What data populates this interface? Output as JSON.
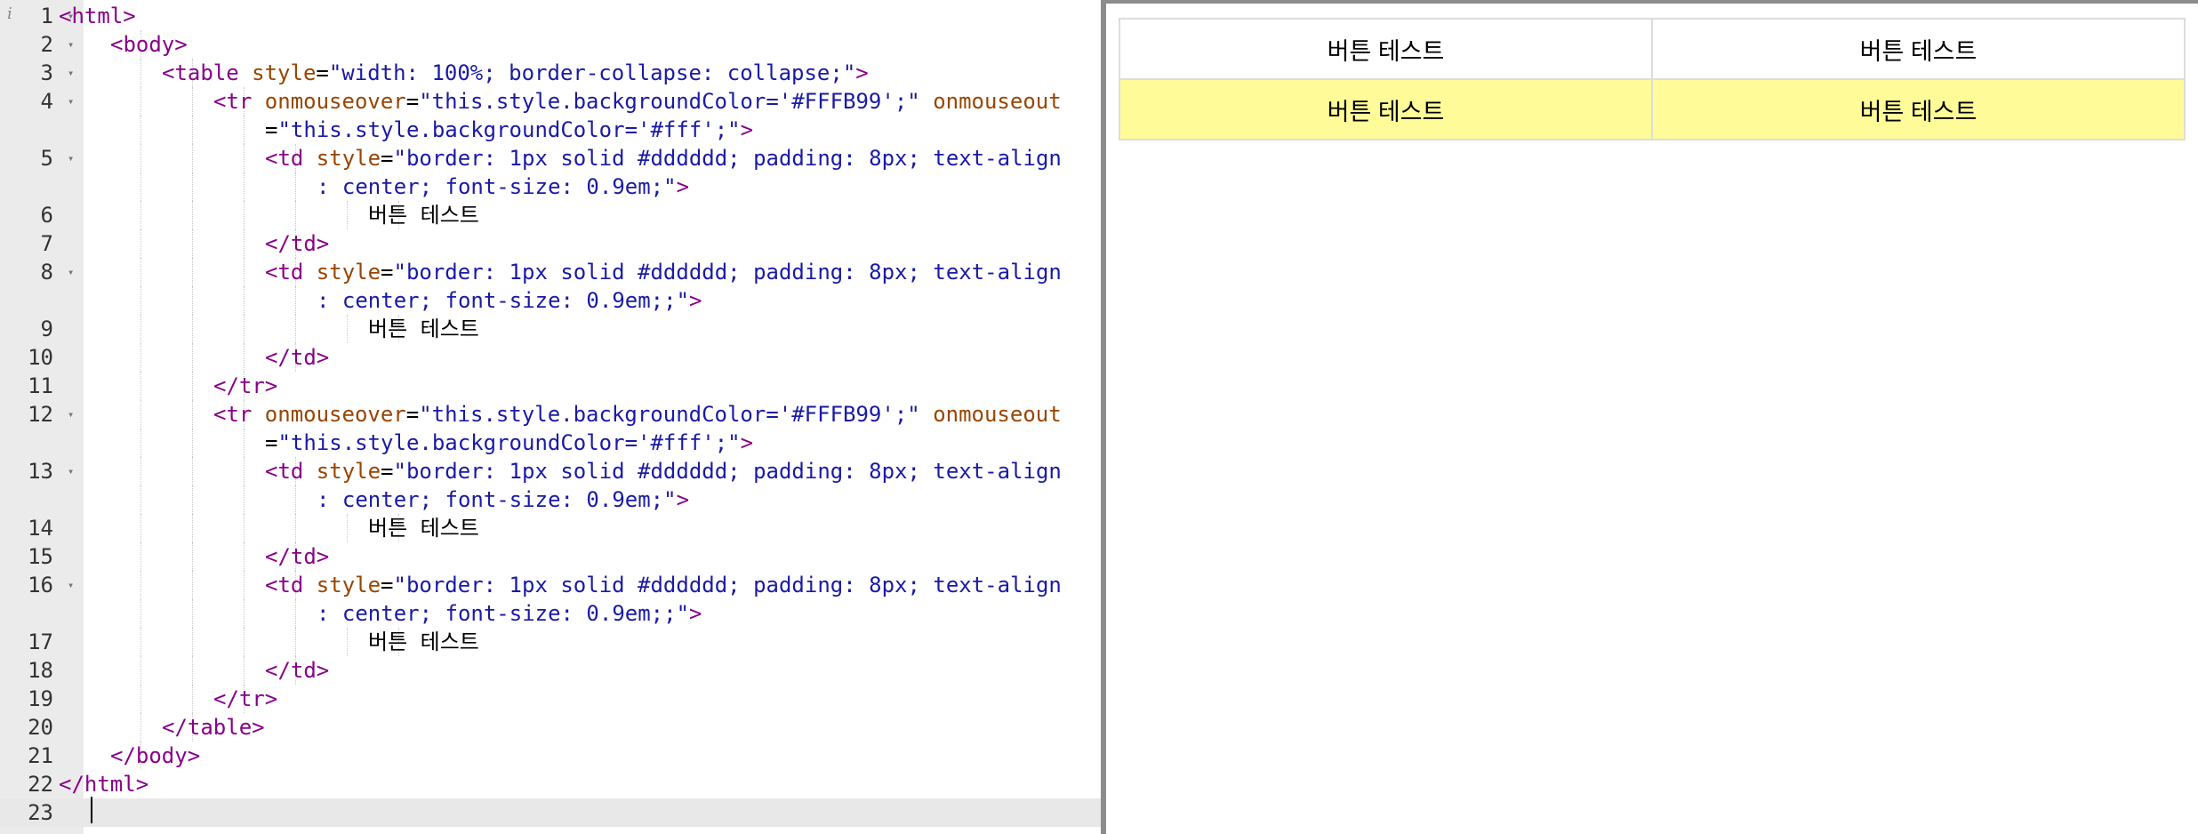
{
  "editor": {
    "active_line": 23,
    "lines": [
      {
        "num": "1",
        "fold": true,
        "indent": 0,
        "tokens": [
          {
            "t": "tag",
            "v": "<html>"
          }
        ]
      },
      {
        "num": "2",
        "fold": true,
        "indent": 1,
        "tokens": [
          {
            "t": "tag",
            "v": "<body>"
          }
        ]
      },
      {
        "num": "3",
        "fold": true,
        "indent": 2,
        "tokens": [
          {
            "t": "tag",
            "v": "<table "
          },
          {
            "t": "attr",
            "v": "style"
          },
          {
            "t": "txt",
            "v": "="
          },
          {
            "t": "str",
            "v": "\"width: 100%; border-collapse: collapse;\""
          },
          {
            "t": "tag",
            "v": ">"
          }
        ]
      },
      {
        "num": "4",
        "fold": true,
        "indent": 3,
        "tokens": [
          {
            "t": "tag",
            "v": "<tr "
          },
          {
            "t": "attr",
            "v": "onmouseover"
          },
          {
            "t": "txt",
            "v": "="
          },
          {
            "t": "str",
            "v": "\"this.style.backgroundColor='#FFFB99';\""
          },
          {
            "t": "txt",
            "v": " "
          },
          {
            "t": "attr",
            "v": "onmouseout"
          }
        ]
      },
      {
        "num": "",
        "fold": false,
        "indent": 4,
        "tokens": [
          {
            "t": "txt",
            "v": "="
          },
          {
            "t": "str",
            "v": "\"this.style.backgroundColor='#fff';\""
          },
          {
            "t": "tag",
            "v": ">"
          }
        ]
      },
      {
        "num": "5",
        "fold": true,
        "indent": 4,
        "tokens": [
          {
            "t": "tag",
            "v": "<td "
          },
          {
            "t": "attr",
            "v": "style"
          },
          {
            "t": "txt",
            "v": "="
          },
          {
            "t": "str",
            "v": "\"border: 1px solid #dddddd; padding: 8px; text-align"
          }
        ]
      },
      {
        "num": "",
        "fold": false,
        "indent": 5,
        "tokens": [
          {
            "t": "str",
            "v": ": center; font-size: 0.9em;\""
          },
          {
            "t": "tag",
            "v": ">"
          }
        ]
      },
      {
        "num": "6",
        "fold": false,
        "indent": 6,
        "tokens": [
          {
            "t": "txt",
            "v": "버튼 테스트"
          }
        ]
      },
      {
        "num": "7",
        "fold": false,
        "indent": 4,
        "tokens": [
          {
            "t": "tag",
            "v": "</td>"
          }
        ]
      },
      {
        "num": "8",
        "fold": true,
        "indent": 4,
        "tokens": [
          {
            "t": "tag",
            "v": "<td "
          },
          {
            "t": "attr",
            "v": "style"
          },
          {
            "t": "txt",
            "v": "="
          },
          {
            "t": "str",
            "v": "\"border: 1px solid #dddddd; padding: 8px; text-align"
          }
        ]
      },
      {
        "num": "",
        "fold": false,
        "indent": 5,
        "tokens": [
          {
            "t": "str",
            "v": ": center; font-size: 0.9em;;\""
          },
          {
            "t": "tag",
            "v": ">"
          }
        ]
      },
      {
        "num": "9",
        "fold": false,
        "indent": 6,
        "tokens": [
          {
            "t": "txt",
            "v": "버튼 테스트"
          }
        ]
      },
      {
        "num": "10",
        "fold": false,
        "indent": 4,
        "tokens": [
          {
            "t": "tag",
            "v": "</td>"
          }
        ]
      },
      {
        "num": "11",
        "fold": false,
        "indent": 3,
        "tokens": [
          {
            "t": "tag",
            "v": "</tr>"
          }
        ]
      },
      {
        "num": "12",
        "fold": true,
        "indent": 3,
        "tokens": [
          {
            "t": "tag",
            "v": "<tr "
          },
          {
            "t": "attr",
            "v": "onmouseover"
          },
          {
            "t": "txt",
            "v": "="
          },
          {
            "t": "str",
            "v": "\"this.style.backgroundColor='#FFFB99';\""
          },
          {
            "t": "txt",
            "v": " "
          },
          {
            "t": "attr",
            "v": "onmouseout"
          }
        ]
      },
      {
        "num": "",
        "fold": false,
        "indent": 4,
        "tokens": [
          {
            "t": "txt",
            "v": "="
          },
          {
            "t": "str",
            "v": "\"this.style.backgroundColor='#fff';\""
          },
          {
            "t": "tag",
            "v": ">"
          }
        ]
      },
      {
        "num": "13",
        "fold": true,
        "indent": 4,
        "tokens": [
          {
            "t": "tag",
            "v": "<td "
          },
          {
            "t": "attr",
            "v": "style"
          },
          {
            "t": "txt",
            "v": "="
          },
          {
            "t": "str",
            "v": "\"border: 1px solid #dddddd; padding: 8px; text-align"
          }
        ]
      },
      {
        "num": "",
        "fold": false,
        "indent": 5,
        "tokens": [
          {
            "t": "str",
            "v": ": center; font-size: 0.9em;\""
          },
          {
            "t": "tag",
            "v": ">"
          }
        ]
      },
      {
        "num": "14",
        "fold": false,
        "indent": 6,
        "tokens": [
          {
            "t": "txt",
            "v": "버튼 테스트"
          }
        ]
      },
      {
        "num": "15",
        "fold": false,
        "indent": 4,
        "tokens": [
          {
            "t": "tag",
            "v": "</td>"
          }
        ]
      },
      {
        "num": "16",
        "fold": true,
        "indent": 4,
        "tokens": [
          {
            "t": "tag",
            "v": "<td "
          },
          {
            "t": "attr",
            "v": "style"
          },
          {
            "t": "txt",
            "v": "="
          },
          {
            "t": "str",
            "v": "\"border: 1px solid #dddddd; padding: 8px; text-align"
          }
        ]
      },
      {
        "num": "",
        "fold": false,
        "indent": 5,
        "tokens": [
          {
            "t": "str",
            "v": ": center; font-size: 0.9em;;\""
          },
          {
            "t": "tag",
            "v": ">"
          }
        ]
      },
      {
        "num": "17",
        "fold": false,
        "indent": 6,
        "tokens": [
          {
            "t": "txt",
            "v": "버튼 테스트"
          }
        ]
      },
      {
        "num": "18",
        "fold": false,
        "indent": 4,
        "tokens": [
          {
            "t": "tag",
            "v": "</td>"
          }
        ]
      },
      {
        "num": "19",
        "fold": false,
        "indent": 3,
        "tokens": [
          {
            "t": "tag",
            "v": "</tr>"
          }
        ]
      },
      {
        "num": "20",
        "fold": false,
        "indent": 2,
        "tokens": [
          {
            "t": "tag",
            "v": "</table>"
          }
        ]
      },
      {
        "num": "21",
        "fold": false,
        "indent": 1,
        "tokens": [
          {
            "t": "tag",
            "v": "</body>"
          }
        ]
      },
      {
        "num": "22",
        "fold": false,
        "indent": 0,
        "tokens": [
          {
            "t": "tag",
            "v": "</html>"
          }
        ]
      },
      {
        "num": "23",
        "fold": false,
        "indent": 0,
        "tokens": []
      }
    ]
  },
  "preview": {
    "hover_color": "#FFFB99",
    "rows": [
      {
        "highlighted": false,
        "cells": [
          "버튼 테스트",
          "버튼 테스트"
        ]
      },
      {
        "highlighted": true,
        "cells": [
          "버튼 테스트",
          "버튼 테스트"
        ]
      }
    ]
  }
}
